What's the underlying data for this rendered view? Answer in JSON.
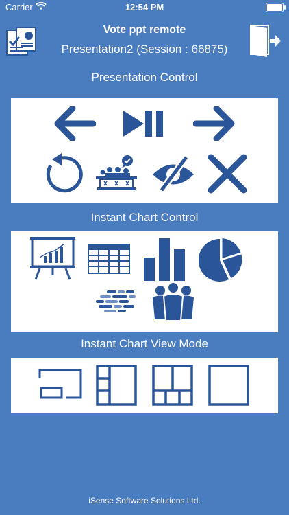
{
  "status_bar": {
    "carrier": "Carrier",
    "time": "12:54 PM"
  },
  "header": {
    "app_name": "Vote ppt remote",
    "session_title": "Presentation2 (Session : 66875)"
  },
  "sections": {
    "presentation_control": "Presentation Control",
    "instant_chart_control": "Instant Chart Control",
    "instant_chart_view_mode": "Instant Chart View Mode"
  },
  "colors": {
    "background": "#4a7cc0",
    "panel": "#ffffff",
    "icon": "#2a5599"
  },
  "icons": {
    "presentation_control": [
      "arrow-left-icon",
      "play-pause-icon",
      "arrow-right-icon",
      "reset-icon",
      "audience-vote-icon",
      "hide-icon",
      "close-icon"
    ],
    "instant_chart_control": [
      "whiteboard-chart-icon",
      "table-icon",
      "bar-chart-icon",
      "pie-chart-icon",
      "word-cloud-icon",
      "audience-icon"
    ],
    "instant_chart_view_mode": [
      "small-view-icon",
      "left-panel-view-icon",
      "grid-view-icon",
      "full-view-icon"
    ]
  },
  "footer": "iSense Software Solutions Ltd."
}
